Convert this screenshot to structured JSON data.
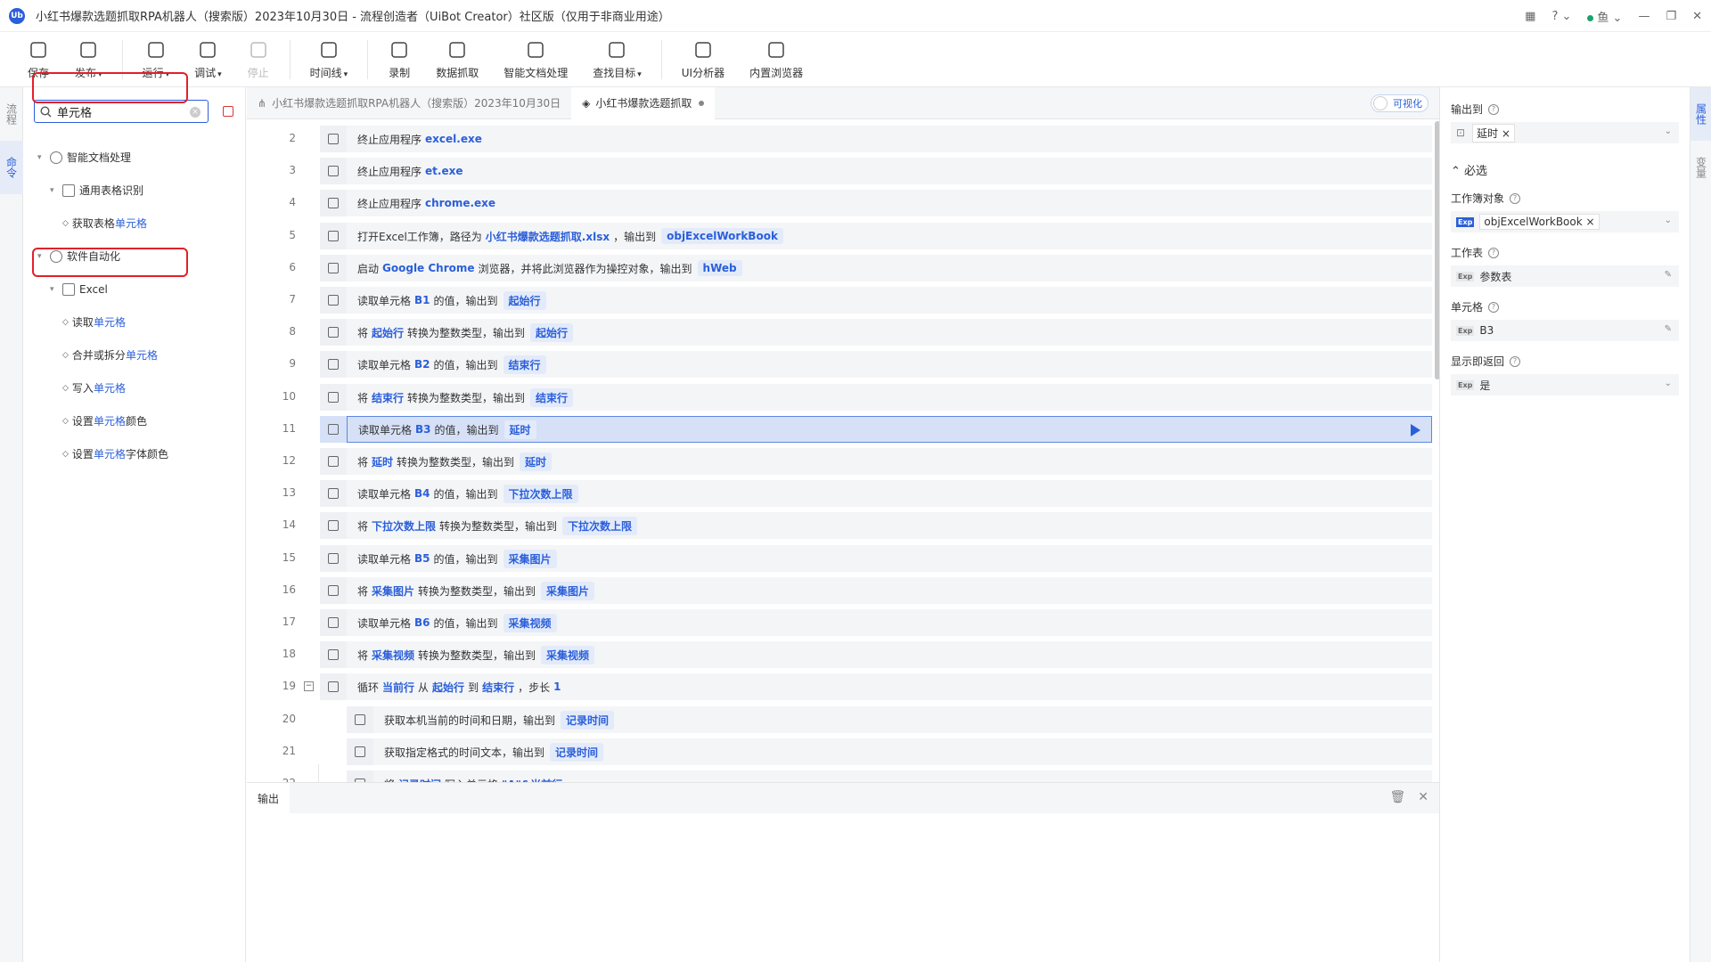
{
  "window": {
    "title": "小红书爆款选题抓取RPA机器人（搜索版）2023年10月30日 - 流程创造者（UiBot Creator）社区版（仅用于非商业用途）",
    "logo_text": "Ub",
    "user_name": "鱼"
  },
  "toolbar": [
    {
      "label": "保存",
      "icon": "save-icon"
    },
    {
      "label": "发布",
      "icon": "paper-plane-icon",
      "caret": true
    },
    {
      "label": "运行",
      "icon": "run-icon",
      "caret": true
    },
    {
      "label": "调试",
      "icon": "debug-icon",
      "caret": true
    },
    {
      "label": "停止",
      "icon": "stop-icon",
      "disabled": true
    },
    {
      "label": "时间线",
      "icon": "clock-icon",
      "caret": true
    },
    {
      "label": "录制",
      "icon": "record-icon"
    },
    {
      "label": "数据抓取",
      "icon": "data-scrape-icon"
    },
    {
      "label": "智能文档处理",
      "icon": "ai-doc-icon"
    },
    {
      "label": "查找目标",
      "icon": "find-target-icon",
      "caret": true
    },
    {
      "label": "UI分析器",
      "icon": "ui-analyzer-icon"
    },
    {
      "label": "内置浏览器",
      "icon": "browser-icon"
    }
  ],
  "left_rail": [
    {
      "label": "流程"
    },
    {
      "label": "命令",
      "active": true
    }
  ],
  "search": {
    "value": "单元格",
    "placeholder": ""
  },
  "tree": [
    {
      "level": 0,
      "type": "group",
      "label": "智能文档处理",
      "icon": "ai-icon",
      "parts": [
        "智能文档处理"
      ]
    },
    {
      "level": 1,
      "type": "group",
      "label": "通用表格识别",
      "icon": "table-scan-icon",
      "parts": [
        "通用表格识别"
      ]
    },
    {
      "level": 2,
      "type": "item",
      "parts": [
        "获取表格",
        "单元格"
      ]
    },
    {
      "level": 0,
      "type": "group",
      "label": "软件自动化",
      "icon": "automation-icon",
      "parts": [
        "软件自动化"
      ]
    },
    {
      "level": 1,
      "type": "group",
      "label": "Excel",
      "icon": "excel-icon",
      "parts": [
        "Excel"
      ]
    },
    {
      "level": 2,
      "type": "item",
      "parts": [
        "读取",
        "单元格"
      ]
    },
    {
      "level": 2,
      "type": "item",
      "parts": [
        "合并或拆分",
        "单元格"
      ]
    },
    {
      "level": 2,
      "type": "item",
      "parts": [
        "写入",
        "单元格"
      ]
    },
    {
      "level": 2,
      "type": "item",
      "parts": [
        "设置",
        "单元格",
        "颜色"
      ]
    },
    {
      "level": 2,
      "type": "item",
      "parts": [
        "设置",
        "单元格",
        "字体颜色"
      ]
    }
  ],
  "tabs": [
    {
      "label": "小红书爆款选题抓取RPA机器人（搜索版）2023年10月30日",
      "icon": "flow-icon"
    },
    {
      "label": "小红书爆款选题抓取",
      "icon": "layers-icon",
      "active": true,
      "modified": true
    }
  ],
  "visualize_label": "可视化",
  "rows": [
    {
      "n": "2",
      "segs": [
        [
          "t",
          "终止应用程序"
        ],
        [
          "k",
          "excel.exe"
        ]
      ]
    },
    {
      "n": "3",
      "segs": [
        [
          "t",
          "终止应用程序"
        ],
        [
          "k",
          "et.exe"
        ]
      ]
    },
    {
      "n": "4",
      "segs": [
        [
          "t",
          "终止应用程序"
        ],
        [
          "k",
          "chrome.exe"
        ]
      ]
    },
    {
      "n": "5",
      "segs": [
        [
          "t",
          "打开Excel工作簿，路径为"
        ],
        [
          "k",
          "小红书爆款选题抓取.xlsx"
        ],
        [
          "t",
          "，输出到"
        ],
        [
          "v",
          "objExcelWorkBook"
        ]
      ]
    },
    {
      "n": "6",
      "segs": [
        [
          "t",
          "启动"
        ],
        [
          "k",
          "Google Chrome"
        ],
        [
          "t",
          "浏览器，并将此浏览器作为操控对象，输出到"
        ],
        [
          "v",
          "hWeb"
        ]
      ]
    },
    {
      "n": "7",
      "segs": [
        [
          "t",
          "读取单元格"
        ],
        [
          "k",
          "B1"
        ],
        [
          "t",
          "的值，输出到"
        ],
        [
          "v",
          "起始行"
        ]
      ]
    },
    {
      "n": "8",
      "segs": [
        [
          "t",
          "将"
        ],
        [
          "k",
          "起始行"
        ],
        [
          "t",
          "转换为整数类型，输出到"
        ],
        [
          "v",
          "起始行"
        ]
      ]
    },
    {
      "n": "9",
      "segs": [
        [
          "t",
          "读取单元格"
        ],
        [
          "k",
          "B2"
        ],
        [
          "t",
          "的值，输出到"
        ],
        [
          "v",
          "结束行"
        ]
      ]
    },
    {
      "n": "10",
      "segs": [
        [
          "t",
          "将"
        ],
        [
          "k",
          "结束行"
        ],
        [
          "t",
          "转换为整数类型，输出到"
        ],
        [
          "v",
          "结束行"
        ]
      ]
    },
    {
      "n": "11",
      "selected": true,
      "segs": [
        [
          "t",
          "读取单元格"
        ],
        [
          "k",
          "B3"
        ],
        [
          "t",
          "的值，输出到"
        ],
        [
          "v",
          "延时"
        ]
      ]
    },
    {
      "n": "12",
      "segs": [
        [
          "t",
          "将"
        ],
        [
          "k",
          "延时"
        ],
        [
          "t",
          "转换为整数类型，输出到"
        ],
        [
          "v",
          "延时"
        ]
      ]
    },
    {
      "n": "13",
      "segs": [
        [
          "t",
          "读取单元格"
        ],
        [
          "k",
          "B4"
        ],
        [
          "t",
          "的值，输出到"
        ],
        [
          "v",
          "下拉次数上限"
        ]
      ]
    },
    {
      "n": "14",
      "segs": [
        [
          "t",
          "将"
        ],
        [
          "k",
          "下拉次数上限"
        ],
        [
          "t",
          "转换为整数类型，输出到"
        ],
        [
          "v",
          "下拉次数上限"
        ]
      ]
    },
    {
      "n": "15",
      "segs": [
        [
          "t",
          "读取单元格"
        ],
        [
          "k",
          "B5"
        ],
        [
          "t",
          "的值，输出到"
        ],
        [
          "v",
          "采集图片"
        ]
      ]
    },
    {
      "n": "16",
      "segs": [
        [
          "t",
          "将"
        ],
        [
          "k",
          "采集图片"
        ],
        [
          "t",
          "转换为整数类型，输出到"
        ],
        [
          "v",
          "采集图片"
        ]
      ]
    },
    {
      "n": "17",
      "segs": [
        [
          "t",
          "读取单元格"
        ],
        [
          "k",
          "B6"
        ],
        [
          "t",
          "的值，输出到"
        ],
        [
          "v",
          "采集视频"
        ]
      ]
    },
    {
      "n": "18",
      "segs": [
        [
          "t",
          "将"
        ],
        [
          "k",
          "采集视频"
        ],
        [
          "t",
          "转换为整数类型，输出到"
        ],
        [
          "v",
          "采集视频"
        ]
      ]
    },
    {
      "n": "19",
      "collapse": true,
      "segs": [
        [
          "t",
          "循环"
        ],
        [
          "k",
          "当前行"
        ],
        [
          "t",
          "从"
        ],
        [
          "k",
          "起始行"
        ],
        [
          "t",
          "到"
        ],
        [
          "k",
          "结束行"
        ],
        [
          "t",
          "，步长"
        ],
        [
          "k",
          "1"
        ]
      ]
    },
    {
      "n": "20",
      "indent": true,
      "segs": [
        [
          "t",
          "获取本机当前的时间和日期，输出到"
        ],
        [
          "v",
          "记录时间"
        ]
      ]
    },
    {
      "n": "21",
      "indent": true,
      "segs": [
        [
          "t",
          "获取指定格式的时间文本，输出到"
        ],
        [
          "v",
          "记录时间"
        ]
      ]
    },
    {
      "n": "22",
      "indent": true,
      "segs": [
        [
          "t",
          "将"
        ],
        [
          "k",
          "记录时间"
        ],
        [
          "t",
          "写入单元格"
        ],
        [
          "k",
          "\"A\"&当前行"
        ]
      ]
    }
  ],
  "output": {
    "title": "输出"
  },
  "properties": {
    "output_to_label": "输出到",
    "output_to_value": "延时",
    "required_label": "必选",
    "workbook_label": "工作簿对象",
    "workbook_value": "objExcelWorkBook",
    "sheet_label": "工作表",
    "sheet_value": "参数表",
    "cell_label": "单元格",
    "cell_value": "B3",
    "display_label": "显示即返回",
    "display_value": "是",
    "exp_tag": "Exp"
  },
  "right_rail": [
    {
      "label": "属性",
      "active": true
    },
    {
      "label": "变量"
    }
  ],
  "colors": {
    "accent": "#2b5fd9",
    "highlight_box": "#e0212a",
    "selected_row": "#d6e1f7"
  }
}
